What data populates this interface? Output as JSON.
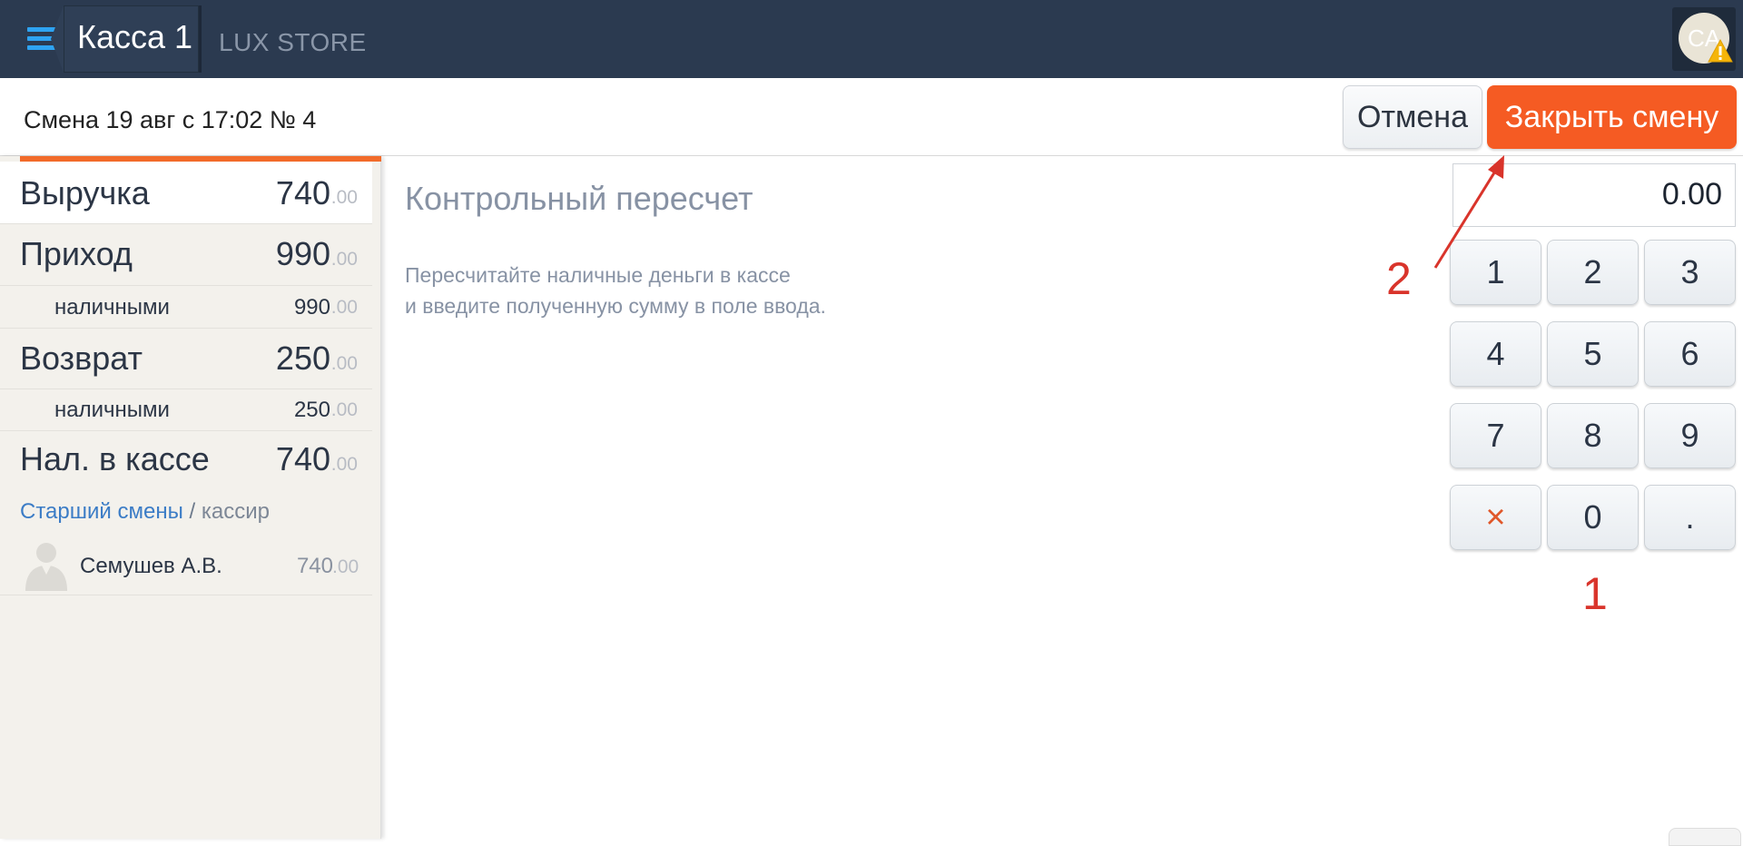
{
  "header": {
    "register_title": "Касса 1",
    "store_name": "LUX STORE",
    "avatar_initials": "CA"
  },
  "subheader": {
    "shift_info": "Смена 19 авг с 17:02 № 4",
    "cancel_label": "Отмена",
    "close_shift_label": "Закрыть смену"
  },
  "summary": {
    "revenue": {
      "label": "Выручка",
      "value": "740",
      "cents": ".00"
    },
    "income": {
      "label": "Приход",
      "value": "990",
      "cents": ".00"
    },
    "income_cash": {
      "label": "наличными",
      "value": "990",
      "cents": ".00"
    },
    "refund": {
      "label": "Возврат",
      "value": "250",
      "cents": ".00"
    },
    "refund_cash": {
      "label": "наличными",
      "value": "250",
      "cents": ".00"
    },
    "cash_in_register": {
      "label": "Нал. в кассе",
      "value": "740",
      "cents": ".00"
    },
    "roles": {
      "senior": "Старший смены",
      "separator": " / ",
      "cashier": "кассир"
    },
    "person": {
      "name": "Семушев А.В.",
      "value": "740",
      "cents": ".00"
    }
  },
  "main": {
    "title": "Контрольный пересчет",
    "description_line1": "Пересчитайте наличные деньги в кассе",
    "description_line2": "и введите полученную сумму в поле ввода."
  },
  "keypad": {
    "amount_value": "0.00",
    "keys": [
      "1",
      "2",
      "3",
      "4",
      "5",
      "6",
      "7",
      "8",
      "9",
      "×",
      "0",
      "."
    ]
  },
  "annotations": {
    "step1": "1",
    "step2": "2"
  },
  "colors": {
    "header_bg": "#2b3a50",
    "accent_orange": "#f55b23",
    "link_blue": "#3b7cc6",
    "annotation_red": "#d9342b"
  }
}
